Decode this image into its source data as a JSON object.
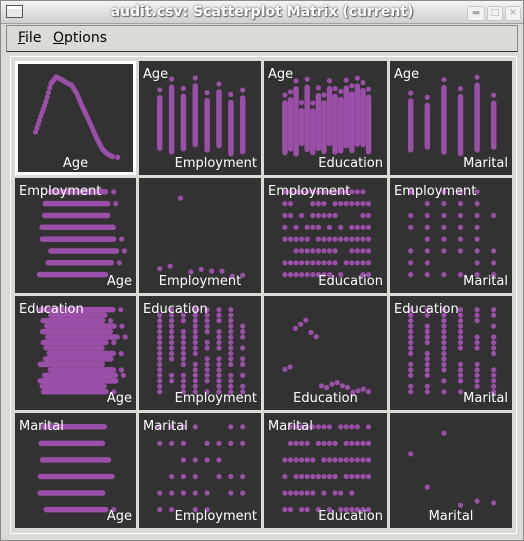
{
  "window": {
    "title": "audit.csv: Scatterplot Matrix (current)",
    "controls": [
      "minimize",
      "maximize",
      "close"
    ]
  },
  "menubar": {
    "items": [
      {
        "label": "File",
        "mnemonic": "F"
      },
      {
        "label": "Options",
        "mnemonic": "O"
      }
    ]
  },
  "colors": {
    "point": "#9b4fa8",
    "cell_bg": "#323232",
    "label": "#ffffff"
  },
  "chart_data": {
    "type": "scatter-matrix",
    "variables": [
      "Age",
      "Employment",
      "Education",
      "Marital"
    ],
    "selected_cell": [
      0,
      0
    ],
    "cells": [
      {
        "row": 0,
        "col": 0,
        "y_label": "",
        "x_label": "Age",
        "kind": "density"
      },
      {
        "row": 0,
        "col": 1,
        "y_label": "Age",
        "x_label": "Employment",
        "kind": "scatter"
      },
      {
        "row": 0,
        "col": 2,
        "y_label": "Age",
        "x_label": "Education",
        "kind": "scatter"
      },
      {
        "row": 0,
        "col": 3,
        "y_label": "Age",
        "x_label": "Marital",
        "kind": "scatter"
      },
      {
        "row": 1,
        "col": 0,
        "y_label": "Employment",
        "x_label": "Age",
        "kind": "scatter"
      },
      {
        "row": 1,
        "col": 1,
        "y_label": "",
        "x_label": "Employment",
        "kind": "density"
      },
      {
        "row": 1,
        "col": 2,
        "y_label": "Employment",
        "x_label": "Education",
        "kind": "scatter"
      },
      {
        "row": 1,
        "col": 3,
        "y_label": "Employment",
        "x_label": "Marital",
        "kind": "scatter"
      },
      {
        "row": 2,
        "col": 0,
        "y_label": "Education",
        "x_label": "Age",
        "kind": "scatter"
      },
      {
        "row": 2,
        "col": 1,
        "y_label": "Education",
        "x_label": "Employment",
        "kind": "scatter"
      },
      {
        "row": 2,
        "col": 2,
        "y_label": "",
        "x_label": "Education",
        "kind": "density"
      },
      {
        "row": 2,
        "col": 3,
        "y_label": "Education",
        "x_label": "Marital",
        "kind": "scatter"
      },
      {
        "row": 3,
        "col": 0,
        "y_label": "Marital",
        "x_label": "Age",
        "kind": "scatter"
      },
      {
        "row": 3,
        "col": 1,
        "y_label": "Marital",
        "x_label": "Employment",
        "kind": "scatter"
      },
      {
        "row": 3,
        "col": 2,
        "y_label": "Marital",
        "x_label": "Education",
        "kind": "scatter"
      },
      {
        "row": 3,
        "col": 3,
        "y_label": "",
        "x_label": "Marital",
        "kind": "density"
      }
    ],
    "density": {
      "Age": [
        0.33,
        0.52,
        0.7,
        0.92,
        1.0,
        0.97,
        0.93,
        0.9,
        0.8,
        0.65,
        0.52,
        0.38,
        0.24,
        0.12,
        0.06,
        0.03,
        0.02
      ],
      "Employment": [
        0.1,
        0.13,
        0.95,
        0.06,
        0.09,
        0.07,
        0.07,
        0.01,
        0.02
      ],
      "Education": [
        0.3,
        0.33,
        0.8,
        0.85,
        0.9,
        0.75,
        0.7,
        0.1,
        0.08,
        0.12,
        0.14,
        0.1,
        0.08,
        0.02,
        0.04,
        0.06,
        0.03
      ],
      "Marital": [
        0.7,
        0.3,
        0.95,
        0.08,
        0.13,
        0.11
      ]
    },
    "levels": {
      "Employment": 8,
      "Education": 16,
      "Marital": 6
    }
  }
}
